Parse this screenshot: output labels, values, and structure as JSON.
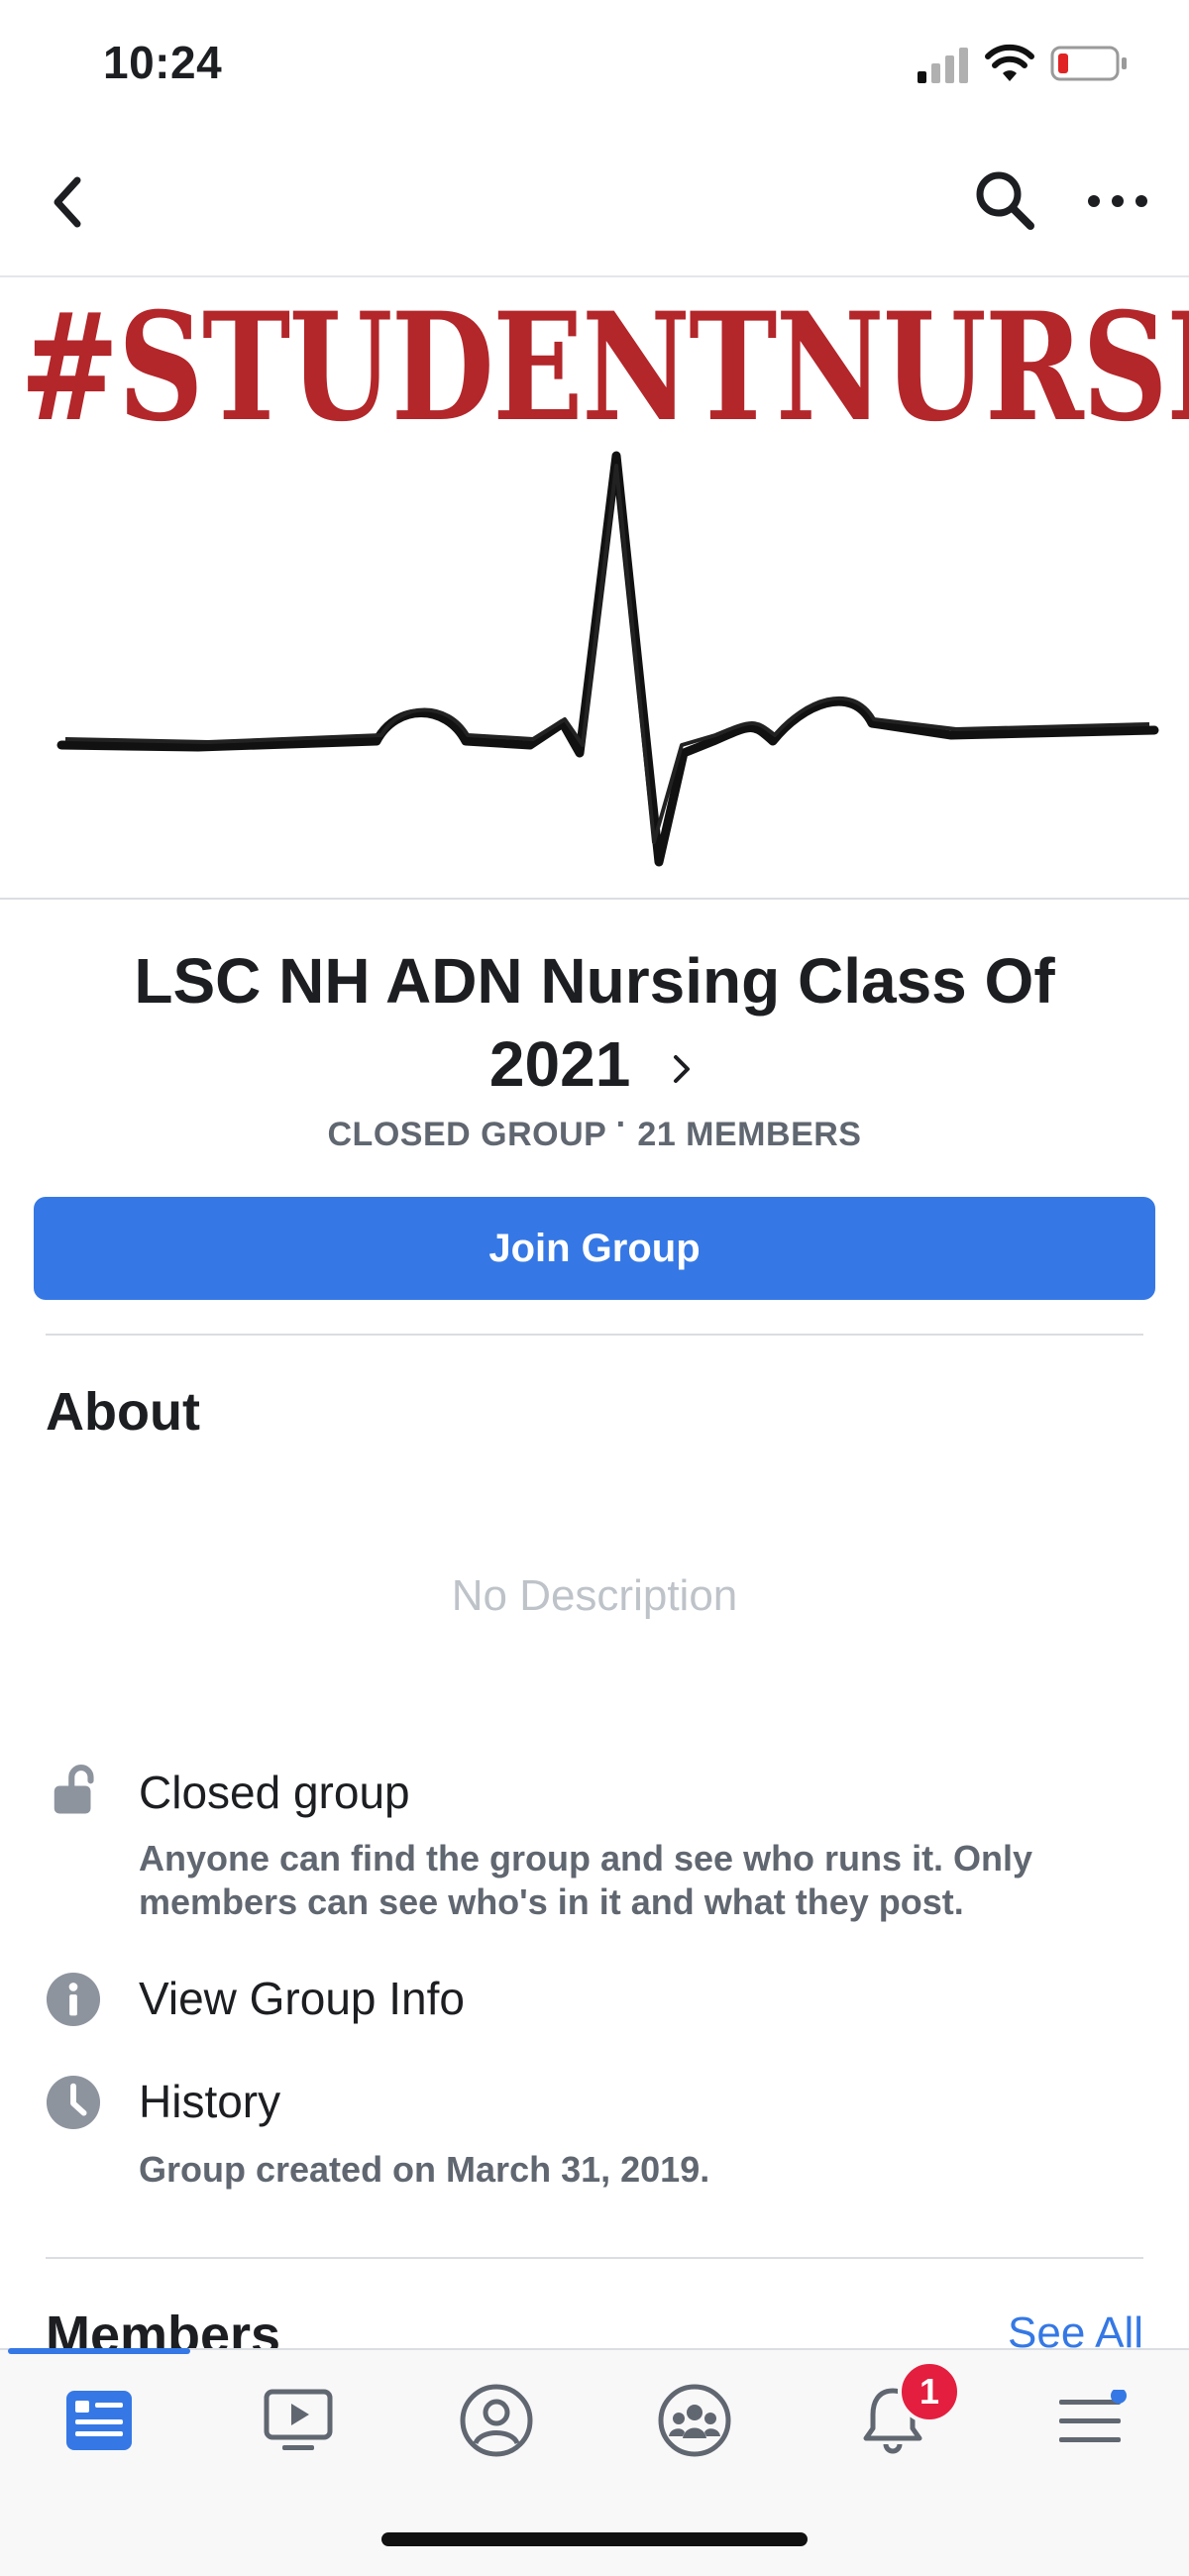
{
  "status_bar": {
    "time": "10:24"
  },
  "cover": {
    "text": "#STUDENTNURSE"
  },
  "group": {
    "title_line1": "LSC NH ADN Nursing Class Of",
    "title_line2": "2021",
    "type": "CLOSED GROUP",
    "separator": "·",
    "members": "21 MEMBERS",
    "join_label": "Join Group"
  },
  "about": {
    "heading": "About",
    "no_description": "No Description",
    "closed_title": "Closed group",
    "closed_desc_line1": "Anyone can find the group and see who runs it. Only",
    "closed_desc_line2": "members can see who's in it and what they post.",
    "view_info": "View Group Info",
    "history_title": "History",
    "history_desc": "Group created on March 31, 2019."
  },
  "members": {
    "heading": "Members",
    "see_all": "See All"
  },
  "bottom_nav": {
    "notifications_count": "1"
  },
  "colors": {
    "accent": "#3578e5",
    "badge": "#e41e3f",
    "cover_text": "#b3262a"
  }
}
